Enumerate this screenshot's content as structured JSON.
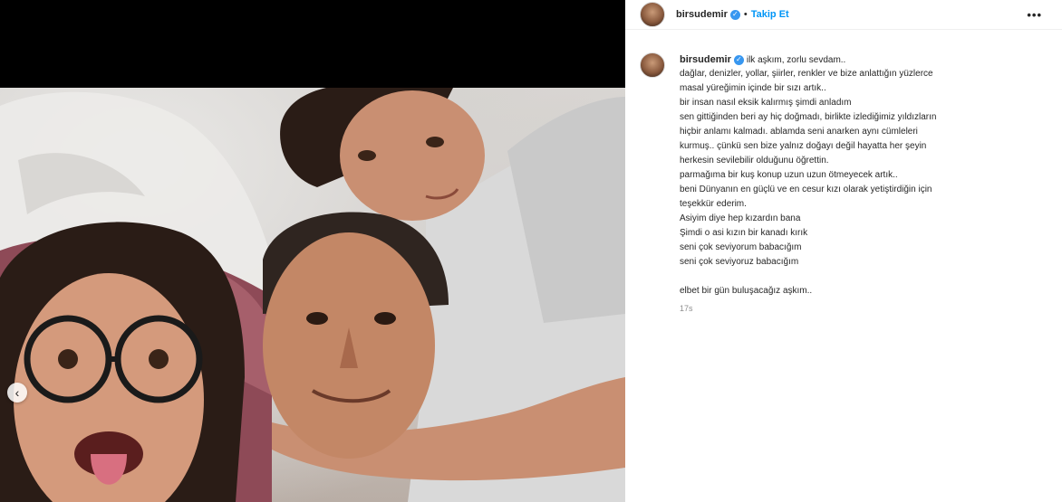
{
  "post": {
    "username": "birsudemir",
    "follow_label": "Takip Et",
    "more_label": "•••",
    "timestamp": "17s",
    "caption_first": "ilk aşkım, zorlu sevdam..",
    "caption_lines": [
      "dağlar, denizler, yollar, şiirler, renkler ve bize anlattığın yüzlerce",
      "masal yüreğimin içinde bir sızı artık..",
      "bir insan nasıl eksik kalırmış şimdi anladım",
      "sen gittiğinden beri ay hiç doğmadı, birlikte izlediğimiz yıldızların",
      "hiçbir anlamı kalmadı. ablamda seni anarken aynı cümleleri",
      "kurmuş.. çünkü sen bize yalnız doğayı değil hayatta her şeyin",
      "herkesin sevilebilir olduğunu öğrettin.",
      "parmağıma bir kuş konup uzun uzun ötmeyecek artık..",
      "beni Dünyanın en güçlü ve en cesur kızı olarak yetiştirdiğin için",
      "teşekkür ederim.",
      "Asiyim diye hep kızardın bana",
      "Şimdi o asi kızın bir kanadı kırık",
      "seni çok seviyorum babacığım",
      "seni çok seviyoruz babacığım"
    ],
    "caption_closing": "elbet bir gün buluşacağız aşkım.."
  },
  "media": {
    "prev_arrow": "‹",
    "colors": {
      "background": "#000000",
      "skin": "#c98f72",
      "hair": "#2a1c16",
      "shirt": "#d9d9d9",
      "pillow": "#8e4a57"
    }
  },
  "colors": {
    "link": "#0095f6",
    "verified": "#3897f0",
    "muted": "#8e8e8e"
  }
}
